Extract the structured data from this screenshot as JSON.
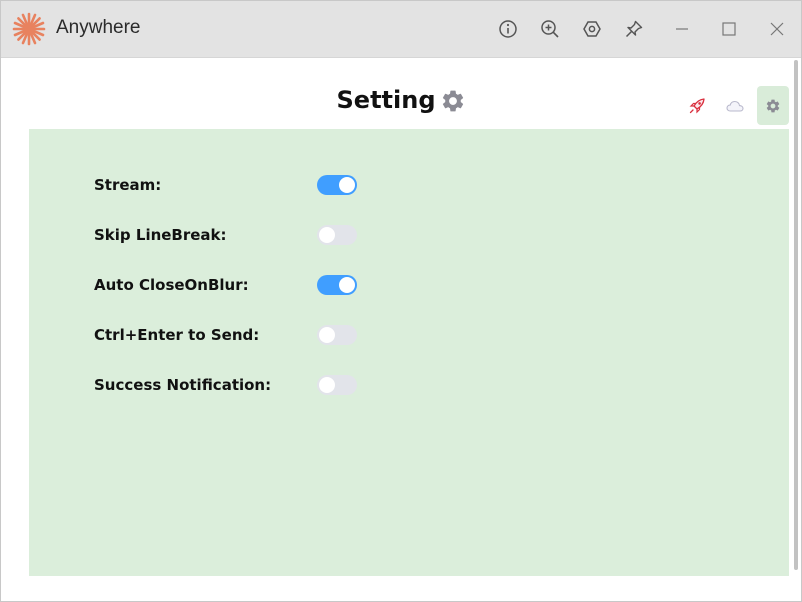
{
  "window": {
    "title": "Anywhere",
    "logo_icon": "sunburst-logo-icon",
    "accent": "#e8825f",
    "toolbar_icons": [
      "info-icon",
      "zoom-in-icon",
      "hexagon-settings-icon",
      "pin-icon"
    ],
    "window_controls": [
      "minimize-icon",
      "maximize-icon",
      "close-icon"
    ]
  },
  "header": {
    "title": "Setting",
    "title_icon": "gear-icon",
    "nav_icons": [
      "rocket-icon",
      "cloud-icon",
      "gear-icon"
    ],
    "active_nav": "gear-icon"
  },
  "settings": {
    "items": [
      {
        "label": "Stream:",
        "on": true
      },
      {
        "label": "Skip LineBreak:",
        "on": false
      },
      {
        "label": "Auto CloseOnBlur:",
        "on": true
      },
      {
        "label": "Ctrl+Enter to Send:",
        "on": false
      },
      {
        "label": "Success Notification:",
        "on": false
      }
    ]
  },
  "colors": {
    "panel_bg": "#dbeedb",
    "toggle_on": "#409eff",
    "toggle_off": "#e2e4ea"
  }
}
